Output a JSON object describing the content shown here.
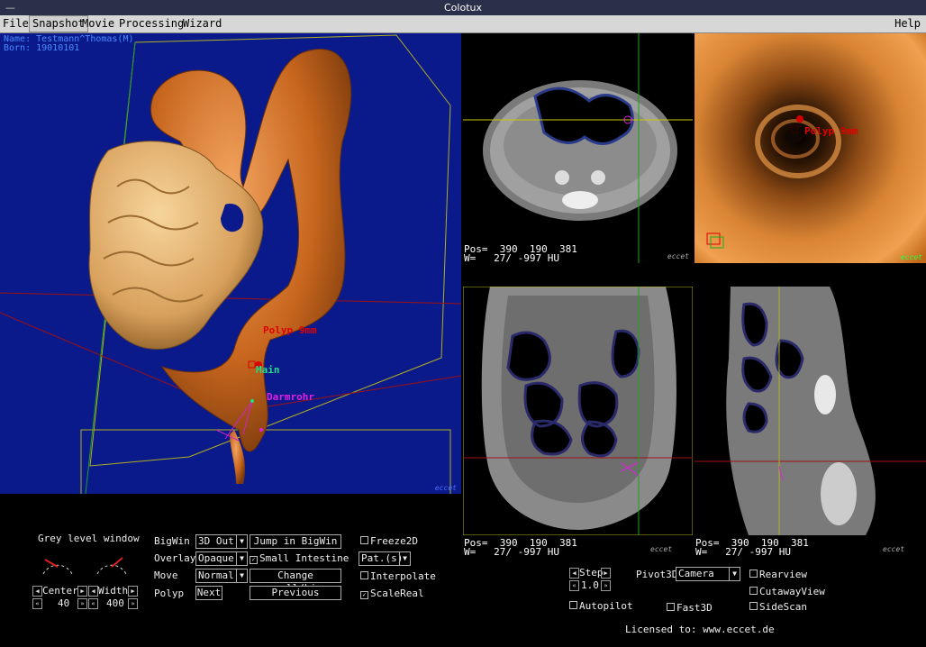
{
  "window": {
    "title": "Colotux",
    "sys_icon": "—"
  },
  "menu": {
    "items": [
      "File",
      "Snapshot",
      "Movie",
      "Processing",
      "Wizard"
    ],
    "help": "Help"
  },
  "big_view": {
    "patient_name": "Name: Testmann^Thomas(M)",
    "patient_born": "Born: 19010101",
    "polyp_label": "Polyp 9mm",
    "main_label": "Main",
    "tube_label": "Darmrohr",
    "logo": "eccet"
  },
  "axial_view": {
    "pos": "Pos=  390  190  381",
    "window": "W=   27/ -997 HU",
    "logo": "eccet"
  },
  "endo_view": {
    "polyp_label": "Polyp 9mm",
    "logo": "eccet"
  },
  "coronal_view": {
    "pos": "Pos=  390  190  381",
    "window": "W=   27/ -997 HU",
    "logo": "eccet"
  },
  "sagittal_view": {
    "pos": "Pos=  390  190  381",
    "window": "W=   27/ -997 HU",
    "logo": "eccet"
  },
  "controls": {
    "grey_level_title": "Grey level window",
    "center_label": "Center",
    "center_value": "40",
    "width_label": "Width",
    "width_value": "400",
    "bigwin_label": "BigWin",
    "bigwin_value": "3D Out",
    "overlay_label": "Overlay",
    "overlay_value": "Opaque",
    "move_label": "Move",
    "move_value": "Normal",
    "polyp_label": "Polyp",
    "next_label": "Next",
    "jump_label": "Jump in BigWin",
    "small_intestine_label": "Small Intestine",
    "change_label": "Change small/big",
    "previous_label": "Previous",
    "freeze_label": "Freeze2D",
    "pat_value": "Pat.(s)",
    "interpolate_label": "Interpolate",
    "scalereal_label": "ScaleReal"
  },
  "controls2": {
    "step_label": "Step",
    "step_value": "1.0",
    "pivot_label": "Pivot3D",
    "pivot_value": "Camera",
    "rearview_label": "Rearview",
    "cutaway_label": "CutawayView",
    "sidescan_label": "SideScan",
    "autopilot_label": "Autopilot",
    "fast3d_label": "Fast3D",
    "license": "Licensed to: www.eccet.de"
  },
  "colors": {
    "bg_blue": "#0b1a8a",
    "colon_orange": "#d9792a",
    "small_intestine": "#e8b36b",
    "polyp_red": "#d80000",
    "main_green": "#22dd88",
    "tube_magenta": "#e020e0"
  }
}
